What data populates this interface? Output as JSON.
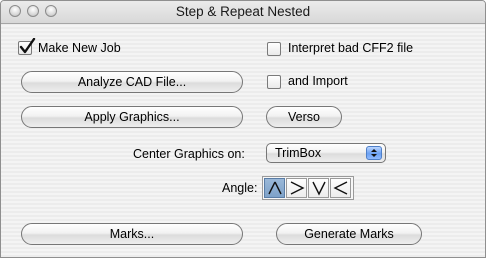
{
  "window": {
    "title": "Step & Repeat Nested"
  },
  "options": {
    "make_new_job": {
      "label": "Make New Job",
      "checked": true
    },
    "interpret_cff2": {
      "label": "Interpret bad CFF2 file",
      "checked": false
    },
    "and_import": {
      "label": "and Import",
      "checked": false
    }
  },
  "buttons": {
    "analyze_cad": "Analyze CAD File...",
    "apply_graphics": "Apply Graphics...",
    "verso": "Verso",
    "marks": "Marks...",
    "generate_marks": "Generate Marks"
  },
  "center_graphics": {
    "label": "Center Graphics on:",
    "selected": "TrimBox"
  },
  "angle": {
    "label": "Angle:",
    "options": [
      "up",
      "right",
      "down",
      "left"
    ],
    "selected": "up"
  },
  "colors": {
    "selected_segment": "#7ea2c9",
    "popup_arrow": "#6aa0f2"
  }
}
